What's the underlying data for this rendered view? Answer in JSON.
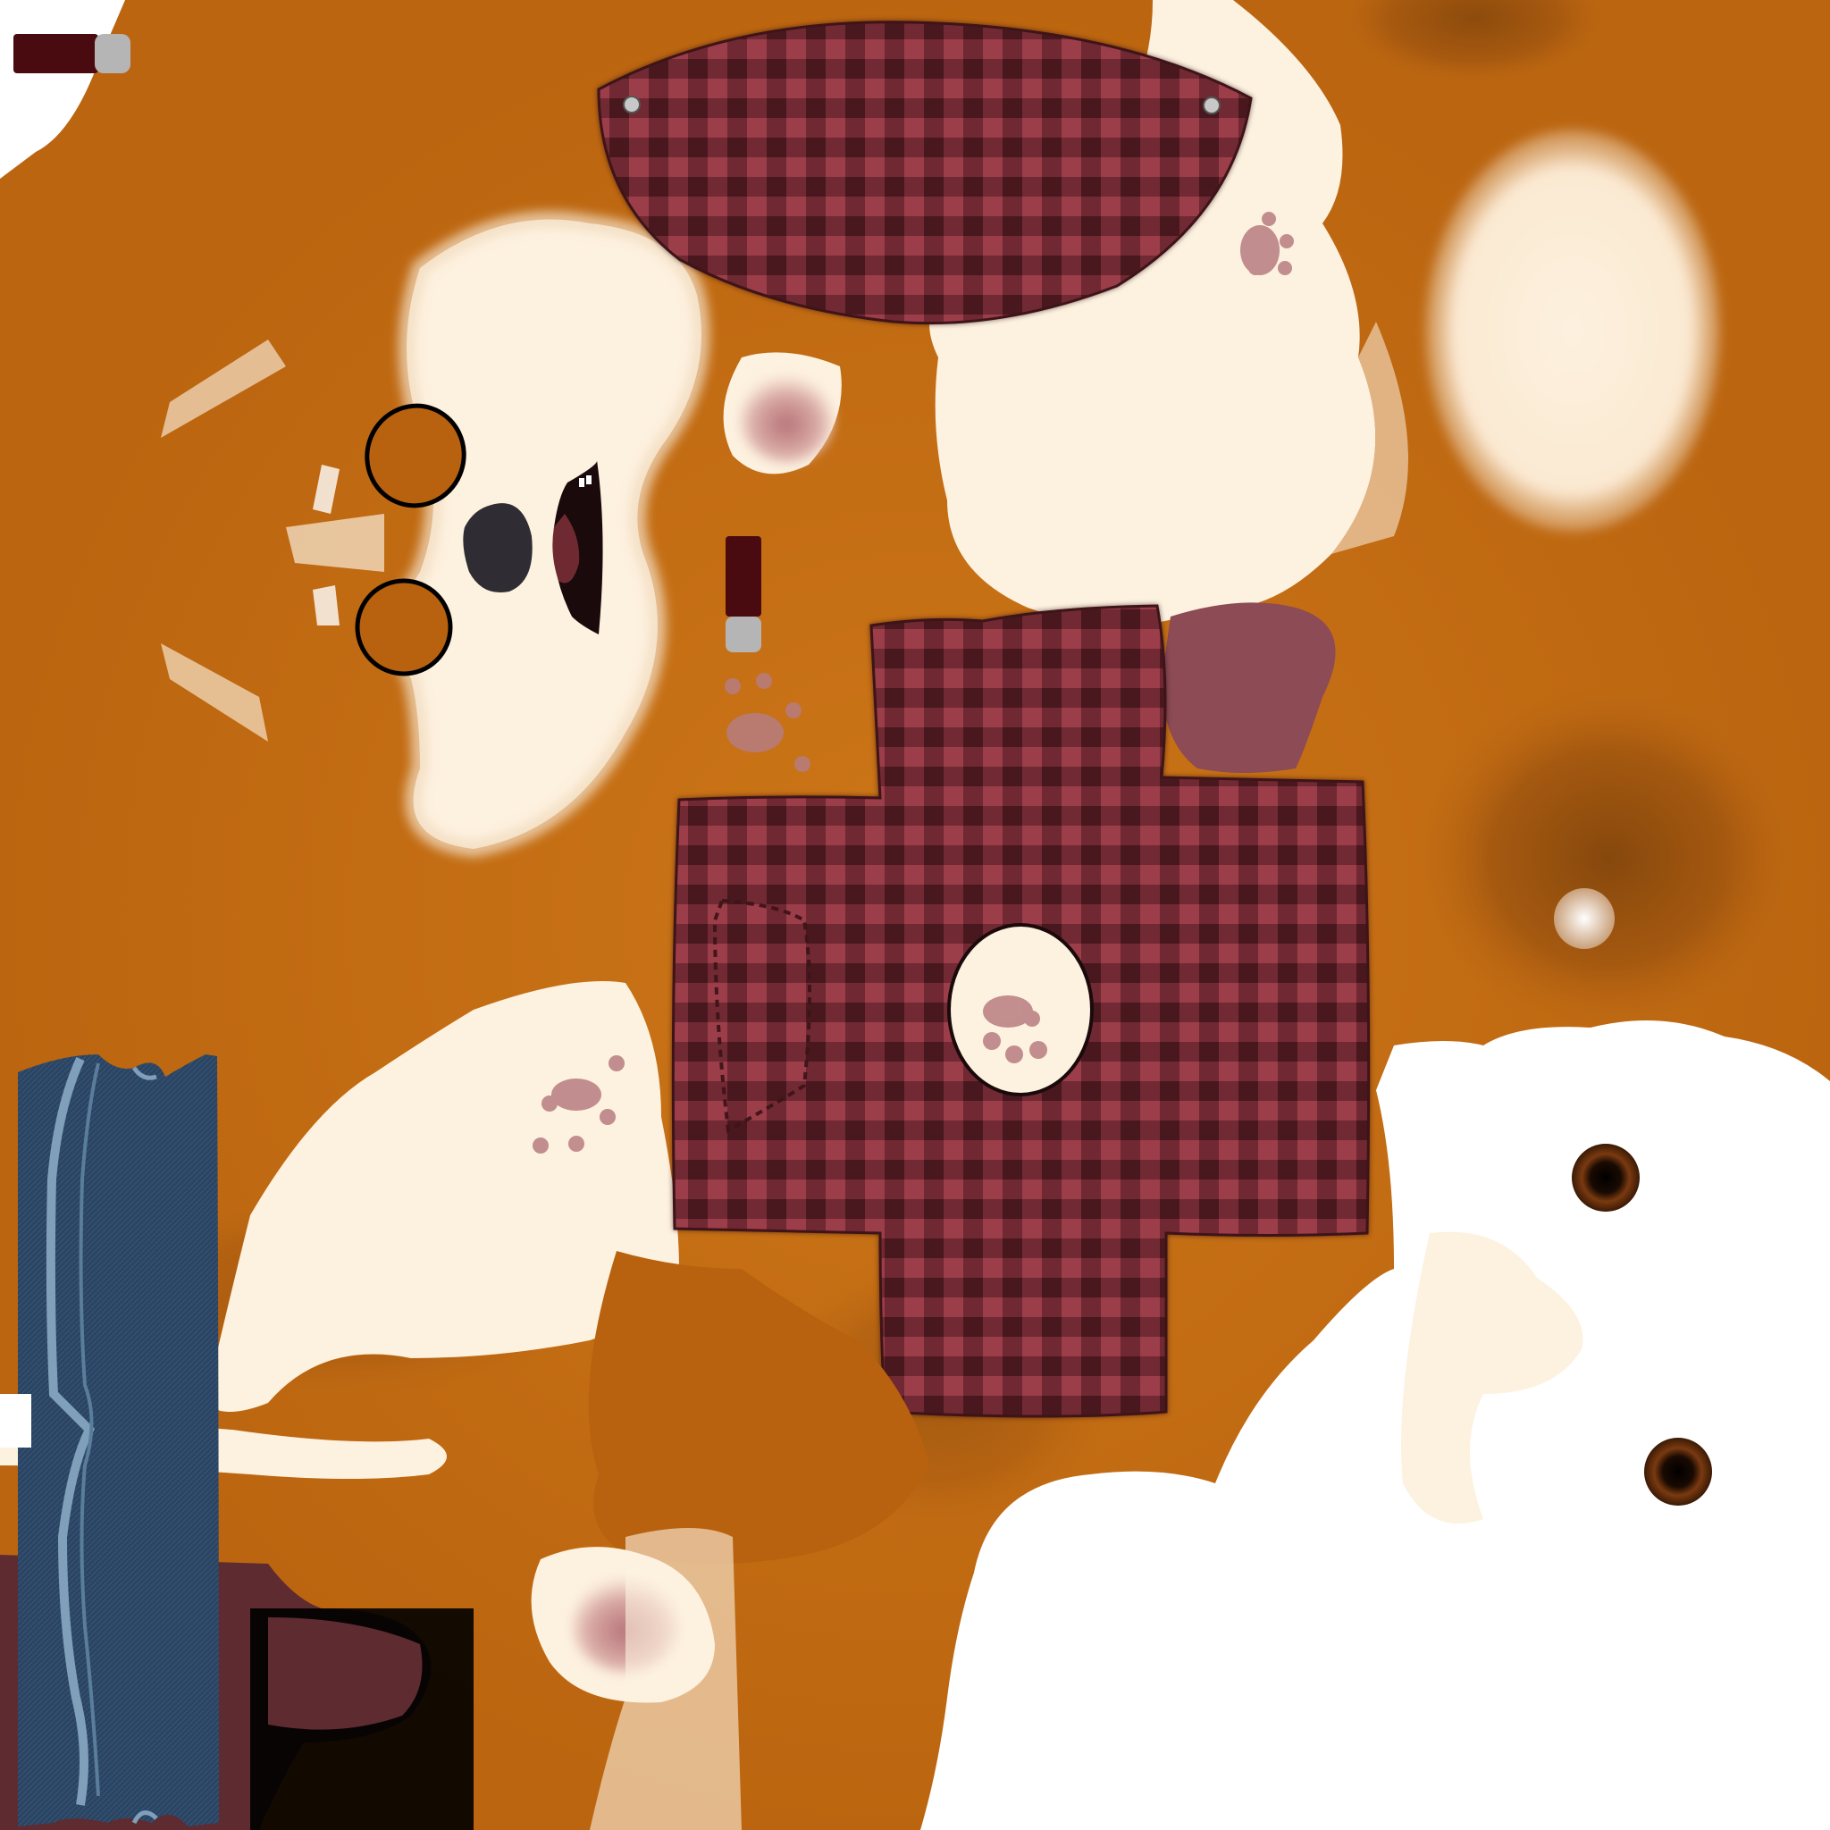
{
  "texture": {
    "kind": "uv-texture-atlas",
    "colors": {
      "fur_orange": "#c06a12",
      "fur_orange_light": "#d47d1c",
      "fur_orange_dark": "#8f4c0e",
      "fur_cream": "#fdf1df",
      "snow_white": "#ffffff",
      "plaid_base": "#7d2e3a",
      "plaid_light": "#a6424f",
      "plaid_dark": "#3e1419",
      "denim": "#2b4462",
      "denim_edge": "#7f9fba",
      "inner_ear_pink": "#c98e8e",
      "paw_pad": "#b77c80",
      "nose": "#2f2d33",
      "mouth": "#1a0a0c",
      "tongue_mauve": "#8c4b55",
      "eye_ring": "#000000",
      "button_brown": "#5a2a0a",
      "strap_maroon": "#4a0b10",
      "strap_grey": "#b5b5b5",
      "boot_maroon": "#5e2b30"
    },
    "islands": [
      "hat-top-plaid",
      "shirt-cross-plaid",
      "shirt-pocket",
      "overall-strap-denim",
      "face-fur",
      "nose",
      "mouth",
      "eye-rings",
      "ears",
      "paw-pads",
      "belly-cream",
      "snow-body-white",
      "buttons",
      "tail-tip",
      "boot-maroon"
    ]
  }
}
